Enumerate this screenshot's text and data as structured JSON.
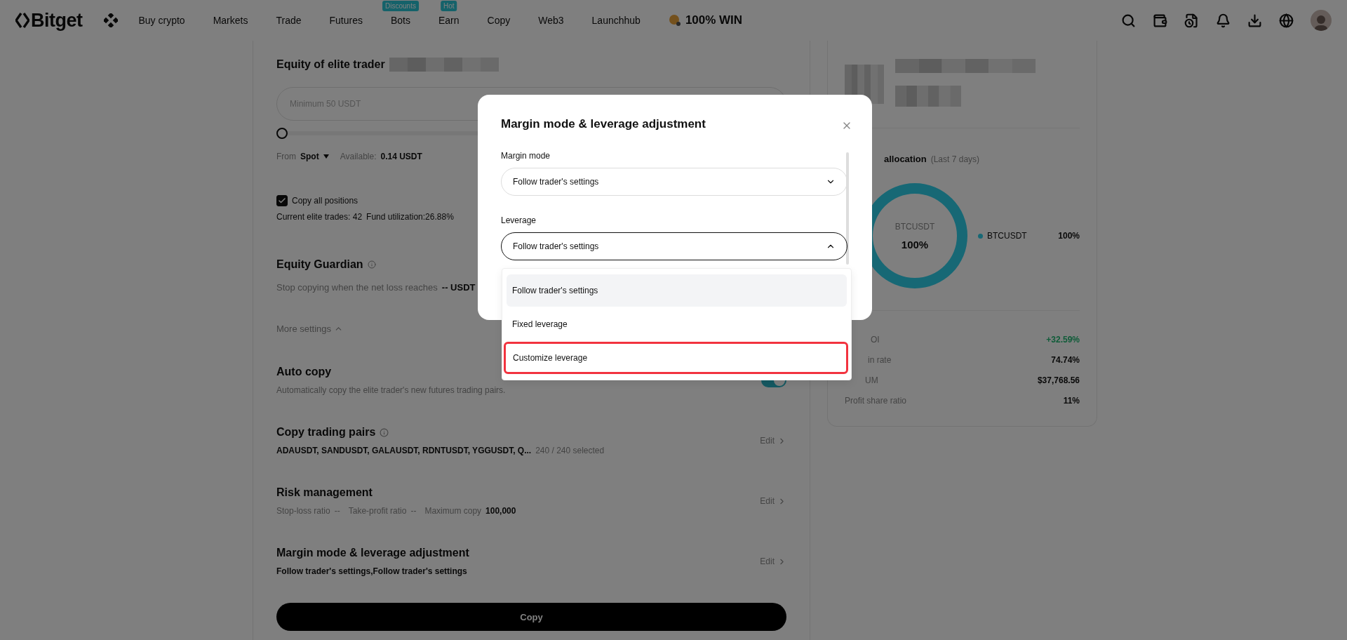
{
  "nav": {
    "logo": "Bitget",
    "items": [
      {
        "label": "Buy crypto"
      },
      {
        "label": "Markets"
      },
      {
        "label": "Trade"
      },
      {
        "label": "Futures"
      },
      {
        "label": "Bots",
        "badge": "Discounts"
      },
      {
        "label": "Earn",
        "badge": "Hot"
      },
      {
        "label": "Copy"
      },
      {
        "label": "Web3"
      },
      {
        "label": "Launchhub"
      }
    ],
    "promo": "100% WIN"
  },
  "form": {
    "equity": {
      "title": "Equity of elite trader",
      "placeholder": "Minimum 50 USDT",
      "level": 0,
      "from_label": "From",
      "from_value": "Spot",
      "available_label": "Available:",
      "available_value": "0.14 USDT"
    },
    "copy_all": {
      "label": "Copy all positions",
      "checked": true,
      "trades": "Current elite trades: 42",
      "utilization": "Fund utilization:26.88%"
    },
    "guardian": {
      "title": "Equity Guardian",
      "text": "Stop copying when the net loss reaches",
      "value": "-- USDT"
    },
    "more_settings": {
      "label": "More settings",
      "expanded": true
    },
    "auto_copy": {
      "title": "Auto copy",
      "description": "Automatically copy the elite trader's new futures trading pairs.",
      "on": true
    },
    "pairs": {
      "title": "Copy trading pairs",
      "value": "ADAUSDT, SANDUSDT, GALAUSDT, RDNTUSDT, YGGUSDT, Q...",
      "count": "240 / 240 selected",
      "action": "Edit"
    },
    "risk": {
      "title": "Risk management",
      "stop_loss_label": "Stop-loss ratio",
      "stop_loss": "--",
      "take_profit_label": "Take-profit ratio",
      "take_profit": "--",
      "max_label": "Maximum copy",
      "max": "100,000",
      "action": "Edit"
    },
    "margin": {
      "title": "Margin mode & leverage adjustment",
      "value": "Follow trader's settings,Follow trader's settings",
      "action": "Edit"
    },
    "copy_button": "Copy"
  },
  "side": {
    "allocation": {
      "title": "allocation",
      "subtitle": "(Last 7 days)",
      "center_value": "100%",
      "center_label": "BTCUSDT",
      "legend": [
        {
          "name": "BTCUSDT",
          "value": "100%"
        }
      ]
    },
    "stats": [
      {
        "label": "OI",
        "value": "+32.59%",
        "positive": true
      },
      {
        "label": "in rate",
        "value": "74.74%",
        "positive": false
      },
      {
        "label": "UM",
        "value": "$37,768.56",
        "positive": false
      },
      {
        "label": "Profit share ratio",
        "value": "11%",
        "positive": false
      }
    ]
  },
  "modal": {
    "title": "Margin mode & leverage adjustment",
    "fields": [
      {
        "label": "Margin mode",
        "value": "Follow trader's settings",
        "open": false
      },
      {
        "label": "Leverage",
        "value": "Follow trader's settings",
        "open": true
      }
    ],
    "options": [
      {
        "label": "Follow trader's settings",
        "selected": true,
        "marked": false
      },
      {
        "label": "Fixed leverage",
        "selected": false,
        "marked": false
      },
      {
        "label": "Customize leverage",
        "selected": false,
        "marked": true
      }
    ]
  }
}
